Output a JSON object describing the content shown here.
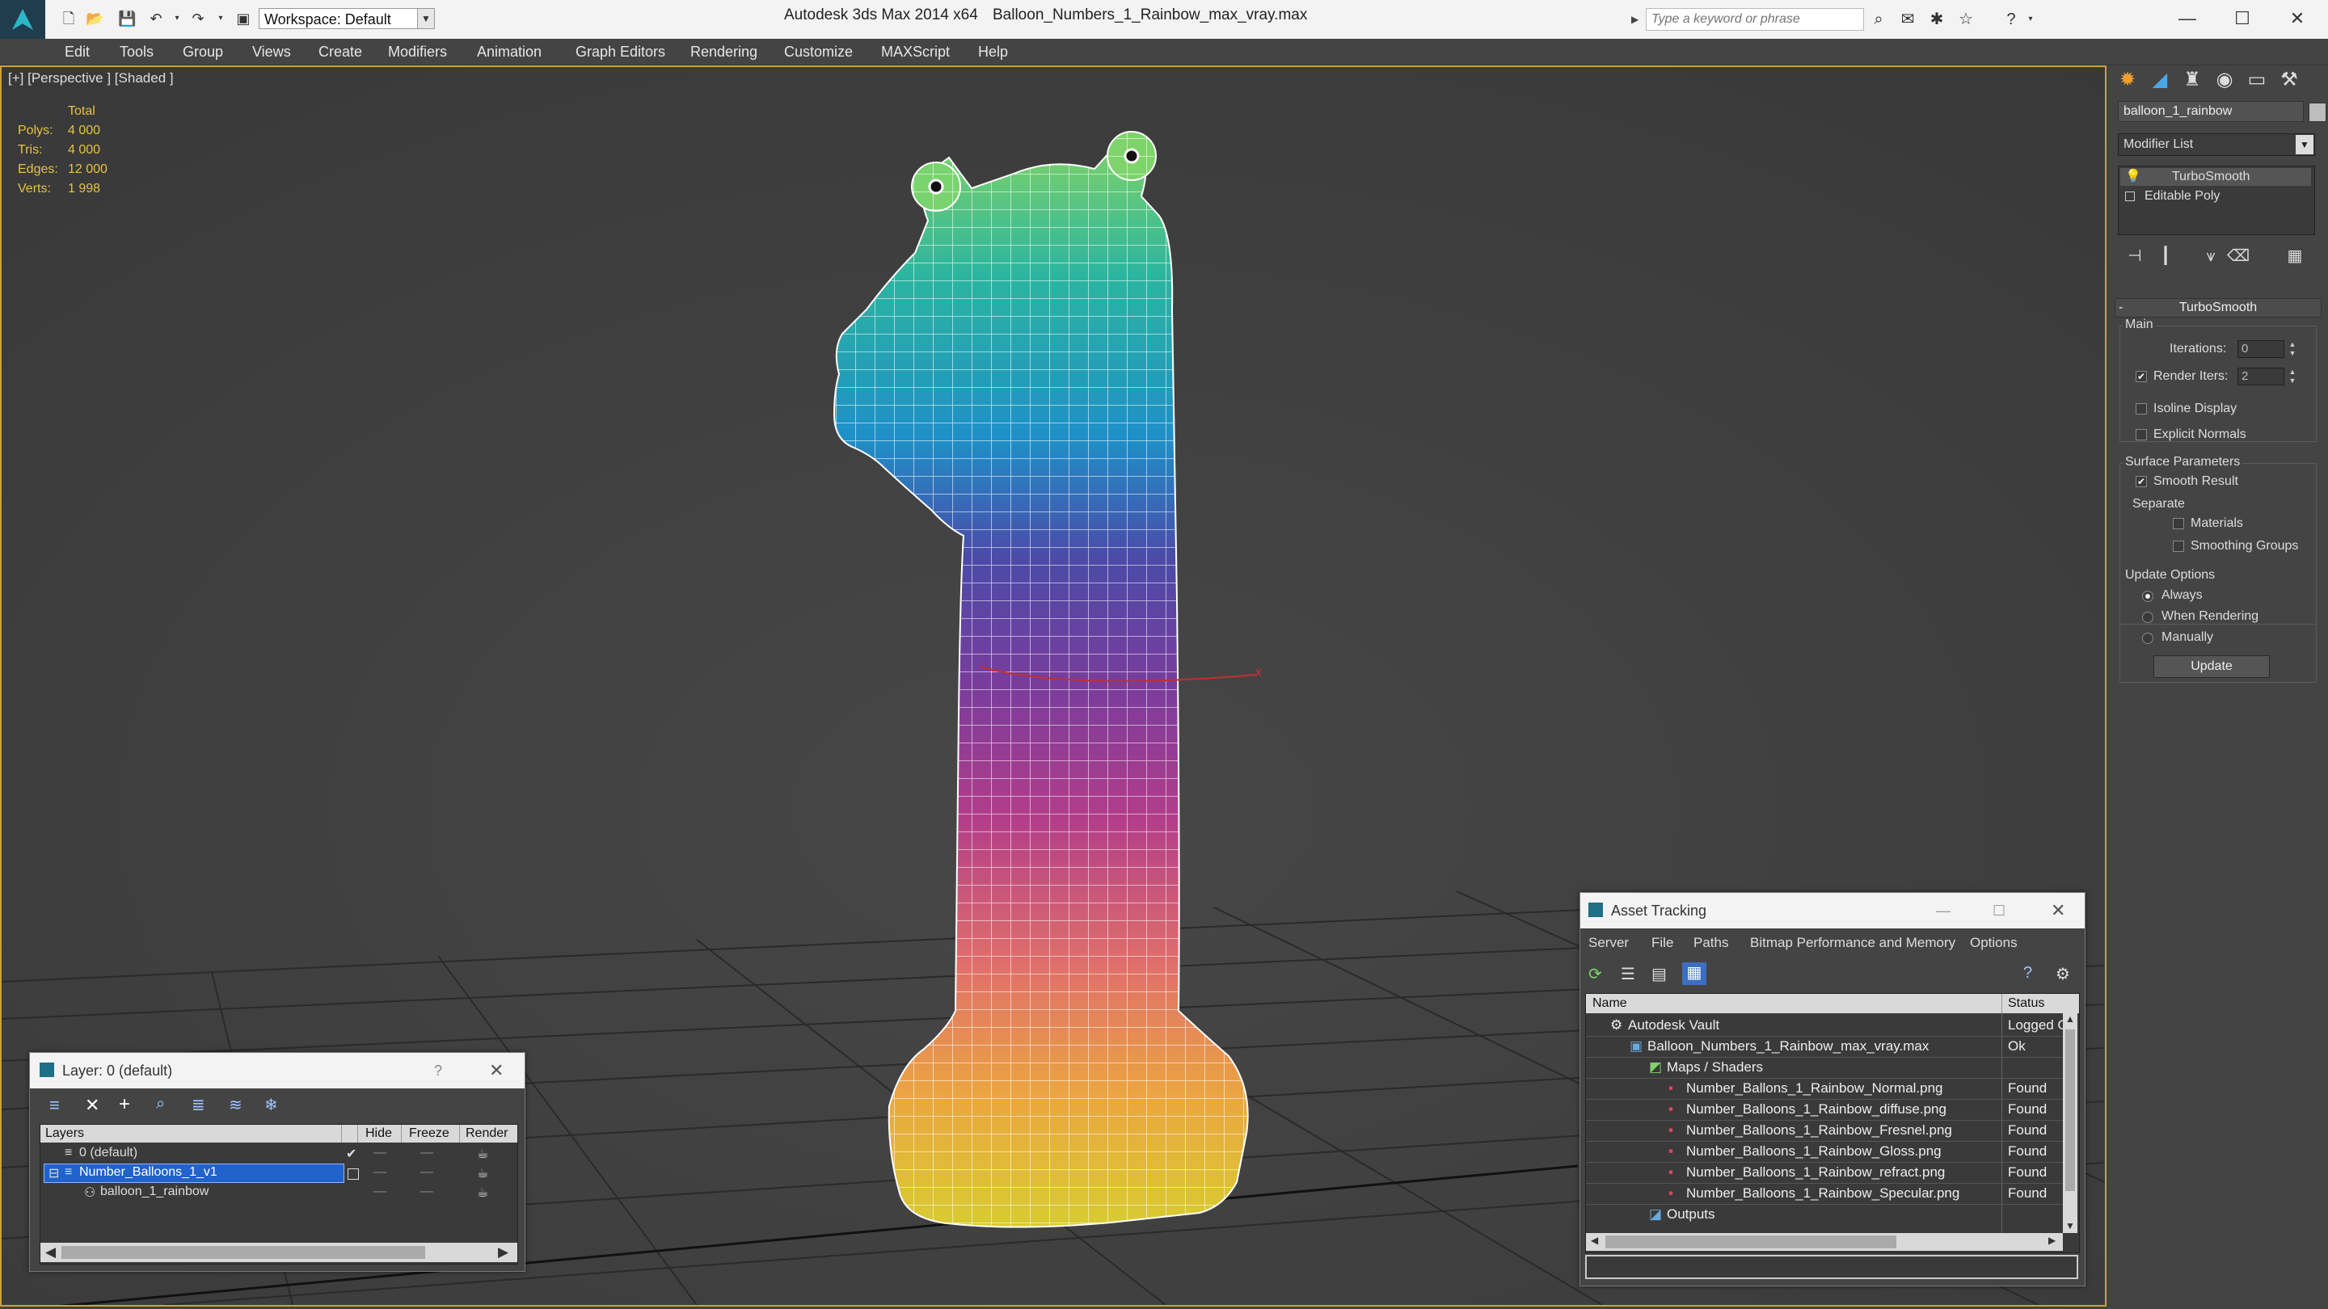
{
  "titlebar": {
    "workspace_label": "Workspace: Default",
    "app_title": "Autodesk 3ds Max  2014 x64",
    "file_title": "Balloon_Numbers_1_Rainbow_max_vray.max",
    "search_placeholder": "Type a keyword or phrase"
  },
  "menu": [
    "Edit",
    "Tools",
    "Group",
    "Views",
    "Create",
    "Modifiers",
    "Animation",
    "Graph Editors",
    "Rendering",
    "Customize",
    "MAXScript",
    "Help"
  ],
  "viewport": {
    "label": "[+] [Perspective ] [Shaded ]",
    "stats": {
      "header": "Total",
      "rows": [
        {
          "label": "Polys:",
          "value": "4 000"
        },
        {
          "label": "Tris:",
          "value": "4 000"
        },
        {
          "label": "Edges:",
          "value": "12 000"
        },
        {
          "label": "Verts:",
          "value": "1 998"
        }
      ]
    },
    "colors": {
      "border": "#c9a33a",
      "background": "#3c3c3c",
      "stats": "#e6c14a"
    }
  },
  "command_panel": {
    "object_name": "balloon_1_rainbow",
    "modifier_list": "Modifier List",
    "stack": [
      "TurboSmooth",
      "Editable Poly"
    ],
    "rollout_title": "TurboSmooth",
    "main_group": "Main",
    "iterations_label": "Iterations:",
    "iterations_value": "0",
    "render_iters_label": "Render Iters:",
    "render_iters_value": "2",
    "render_iters_checked": true,
    "isoline_label": "Isoline Display",
    "isoline_checked": false,
    "explicit_normals_label": "Explicit Normals",
    "explicit_normals_checked": false,
    "surface_group": "Surface Parameters",
    "smooth_result_label": "Smooth Result",
    "smooth_result_checked": true,
    "separate_label": "Separate",
    "materials_label": "Materials",
    "materials_checked": false,
    "smoothing_groups_label": "Smoothing Groups",
    "smoothing_groups_checked": false,
    "update_group": "Update Options",
    "radio_always": "Always",
    "radio_when_rendering": "When Rendering",
    "radio_manually": "Manually",
    "selected_update_option": "Always",
    "update_button": "Update"
  },
  "layer_panel": {
    "title": "Layer: 0 (default)",
    "columns": [
      "Layers",
      "Hide",
      "Freeze",
      "Render"
    ],
    "rows": [
      {
        "name": "0 (default)",
        "selected": false
      },
      {
        "name": "Number_Balloons_1_v1",
        "selected": true
      },
      {
        "name": "balloon_1_rainbow",
        "selected": false
      }
    ]
  },
  "asset_tracking": {
    "title": "Asset Tracking",
    "menu": [
      "Server",
      "File",
      "Paths",
      "Bitmap Performance and Memory",
      "Options"
    ],
    "columns": [
      "Name",
      "Status"
    ],
    "rows": [
      {
        "name": "Autodesk Vault",
        "status": "Logged O"
      },
      {
        "name": "Balloon_Numbers_1_Rainbow_max_vray.max",
        "status": "Ok"
      },
      {
        "name": "Maps / Shaders",
        "status": ""
      },
      {
        "name": "Number_Ballons_1_Rainbow_Normal.png",
        "status": "Found"
      },
      {
        "name": "Number_Balloons_1_Rainbow_diffuse.png",
        "status": "Found"
      },
      {
        "name": "Number_Balloons_1_Rainbow_Fresnel.png",
        "status": "Found"
      },
      {
        "name": "Number_Balloons_1_Rainbow_Gloss.png",
        "status": "Found"
      },
      {
        "name": "Number_Balloons_1_Rainbow_refract.png",
        "status": "Found"
      },
      {
        "name": "Number_Balloons_1_Rainbow_Specular.png",
        "status": "Found"
      },
      {
        "name": "Outputs",
        "status": ""
      }
    ]
  }
}
